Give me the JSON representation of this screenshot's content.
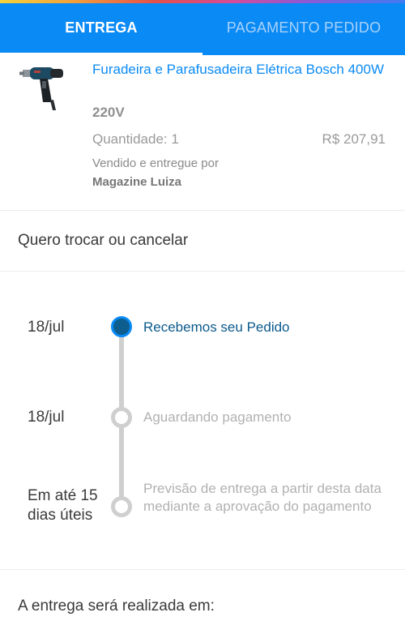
{
  "tabs": [
    {
      "label": "ENTREGA",
      "active": true
    },
    {
      "label": "PAGAMENTO PEDIDO",
      "active": false
    }
  ],
  "product": {
    "title": "Furadeira e Parafusadeira Elétrica Bosch 400W",
    "variant": "220V",
    "quantity_label": "Quantidade: 1",
    "price": "R$ 207,91",
    "sold_by_label": "Vendido e entregue por",
    "seller": "Magazine Luiza",
    "image_icon": "drill-image"
  },
  "exchange_label": "Quero trocar ou cancelar",
  "timeline": [
    {
      "date": "18/jul",
      "status": "Recebemos seu Pedido",
      "state": "done"
    },
    {
      "date": "18/jul",
      "status": "Aguardando pagamento",
      "state": "pending"
    },
    {
      "date": "Em até 15 dias úteis",
      "status": "Previsão de entrega a partir desta data mediante a aprovação do pagamento",
      "state": "pending"
    }
  ],
  "delivery_label": "A entrega será realizada em:",
  "colors": {
    "brand_blue": "#0a8af5",
    "done_status": "#0b5a8c",
    "pending": "#cfcfcf"
  }
}
